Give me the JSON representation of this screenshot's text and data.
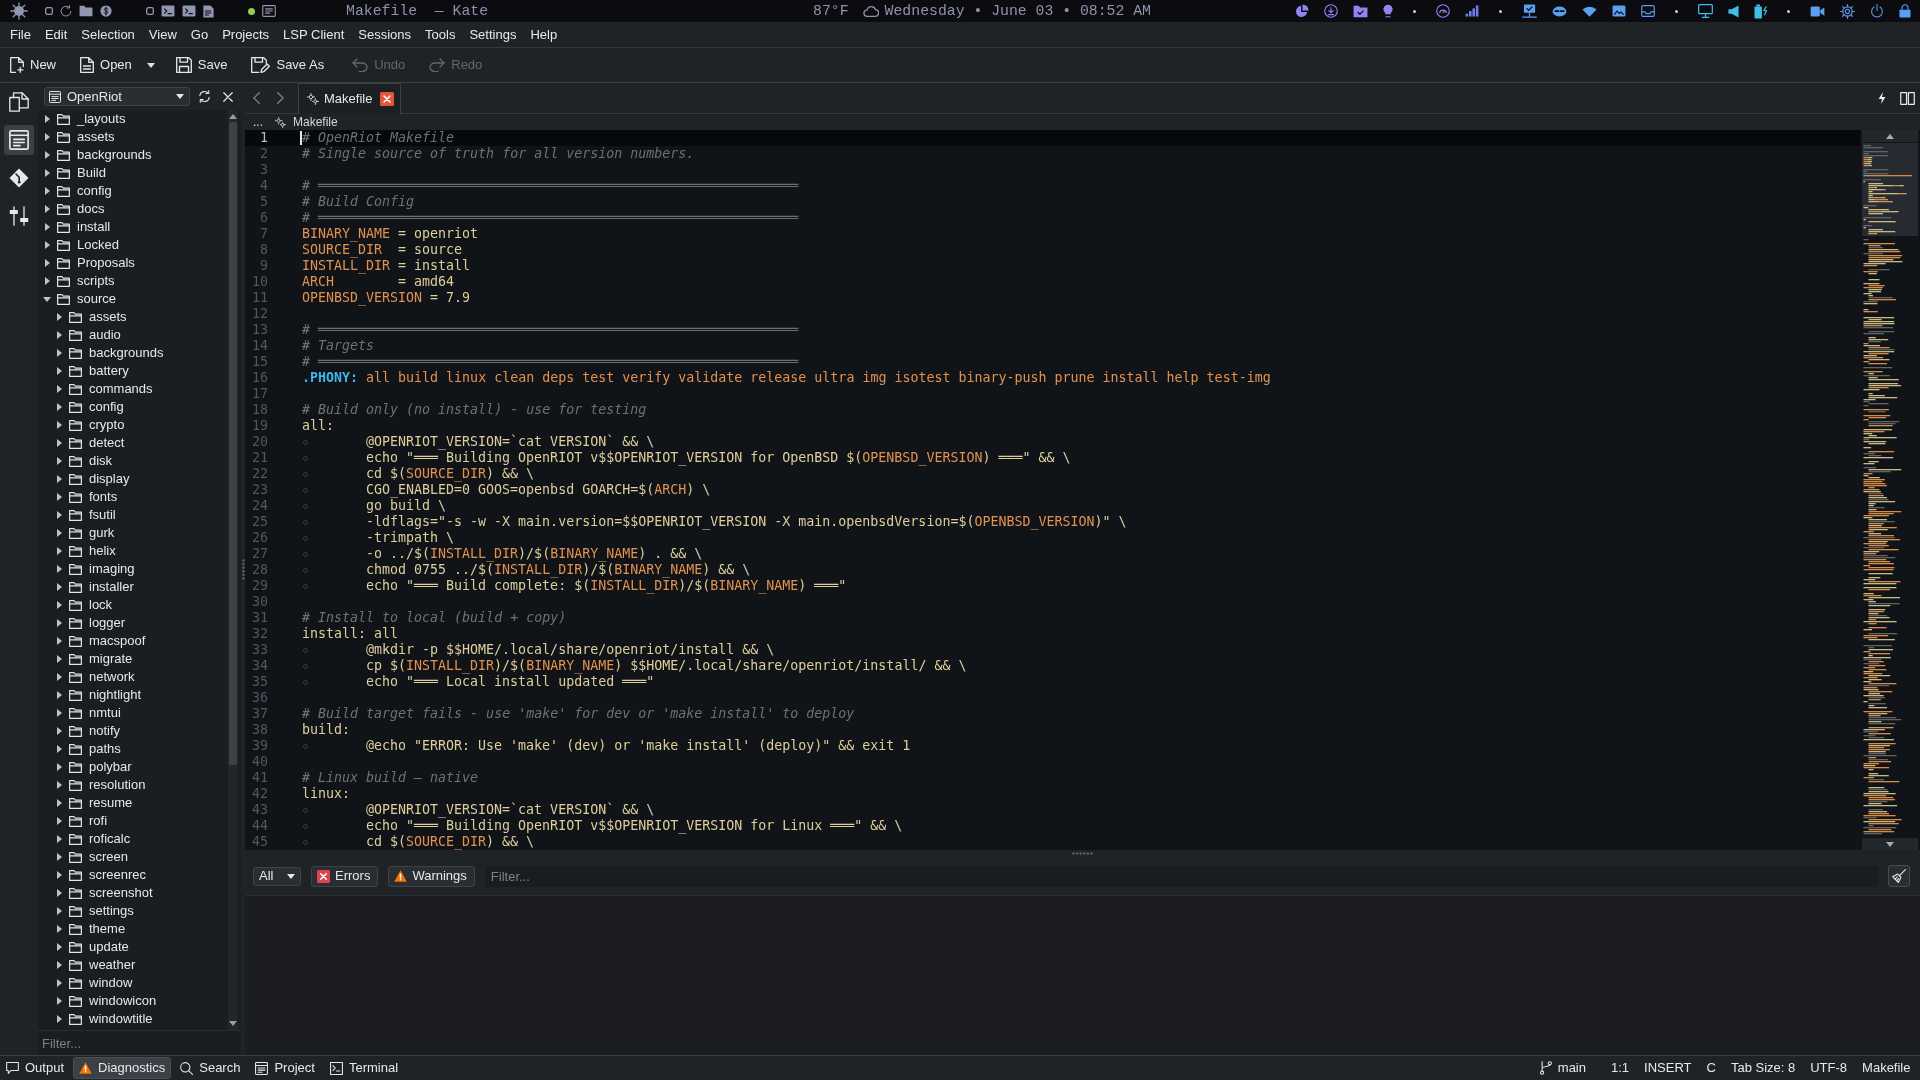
{
  "top_panel": {
    "title": "Makefile  — Kate",
    "weather": "87°F",
    "clock": "Wednesday • June 03 • 08:52 AM"
  },
  "menu_bar": [
    "File",
    "Edit",
    "Selection",
    "View",
    "Go",
    "Projects",
    "LSP Client",
    "Sessions",
    "Tools",
    "Settings",
    "Help"
  ],
  "toolbar": [
    {
      "kind": "new",
      "label": "New",
      "disabled": false,
      "dropdown": false
    },
    {
      "kind": "open",
      "label": "Open",
      "disabled": false,
      "dropdown": true
    },
    {
      "kind": "save",
      "label": "Save",
      "disabled": false,
      "dropdown": false
    },
    {
      "kind": "save_as",
      "label": "Save As",
      "disabled": false,
      "dropdown": false
    },
    {
      "kind": "undo",
      "label": "Undo",
      "disabled": true,
      "dropdown": false
    },
    {
      "kind": "redo",
      "label": "Redo",
      "disabled": true,
      "dropdown": false
    }
  ],
  "tool_views": [
    {
      "kind": "documents",
      "selected": false
    },
    {
      "kind": "projects",
      "selected": true
    },
    {
      "kind": "git",
      "selected": false
    },
    {
      "kind": "compare",
      "selected": false
    }
  ],
  "sidebar": {
    "project": "OpenRiot",
    "tree": [
      {
        "label": "_layouts",
        "expanded": false
      },
      {
        "label": "assets",
        "expanded": false
      },
      {
        "label": "backgrounds",
        "expanded": false
      },
      {
        "label": "Build",
        "expanded": false
      },
      {
        "label": "config",
        "expanded": false
      },
      {
        "label": "docs",
        "expanded": false
      },
      {
        "label": "install",
        "expanded": false
      },
      {
        "label": "Locked",
        "expanded": false
      },
      {
        "label": "Proposals",
        "expanded": false
      },
      {
        "label": "scripts",
        "expanded": false
      },
      {
        "label": "source",
        "expanded": true,
        "children": [
          {
            "label": "assets",
            "expanded": false
          },
          {
            "label": "audio",
            "expanded": false
          },
          {
            "label": "backgrounds",
            "expanded": false
          },
          {
            "label": "battery",
            "expanded": false
          },
          {
            "label": "commands",
            "expanded": false
          },
          {
            "label": "config",
            "expanded": false
          },
          {
            "label": "crypto",
            "expanded": false
          },
          {
            "label": "detect",
            "expanded": false
          },
          {
            "label": "disk",
            "expanded": false
          },
          {
            "label": "display",
            "expanded": false
          },
          {
            "label": "fonts",
            "expanded": false
          },
          {
            "label": "fsutil",
            "expanded": false
          },
          {
            "label": "gurk",
            "expanded": false
          },
          {
            "label": "helix",
            "expanded": false
          },
          {
            "label": "imaging",
            "expanded": false
          },
          {
            "label": "installer",
            "expanded": false
          },
          {
            "label": "lock",
            "expanded": false
          },
          {
            "label": "logger",
            "expanded": false
          },
          {
            "label": "macspoof",
            "expanded": false
          },
          {
            "label": "migrate",
            "expanded": false
          },
          {
            "label": "network",
            "expanded": false
          },
          {
            "label": "nightlight",
            "expanded": false
          },
          {
            "label": "nmtui",
            "expanded": false
          },
          {
            "label": "notify",
            "expanded": false
          },
          {
            "label": "paths",
            "expanded": false
          },
          {
            "label": "polybar",
            "expanded": false
          },
          {
            "label": "resolution",
            "expanded": false
          },
          {
            "label": "resume",
            "expanded": false
          },
          {
            "label": "rofi",
            "expanded": false
          },
          {
            "label": "roficalc",
            "expanded": false
          },
          {
            "label": "screen",
            "expanded": false
          },
          {
            "label": "screenrec",
            "expanded": false
          },
          {
            "label": "screenshot",
            "expanded": false
          },
          {
            "label": "settings",
            "expanded": false
          },
          {
            "label": "theme",
            "expanded": false
          },
          {
            "label": "update",
            "expanded": false
          },
          {
            "label": "weather",
            "expanded": false
          },
          {
            "label": "window",
            "expanded": false
          },
          {
            "label": "windowicon",
            "expanded": false
          },
          {
            "label": "windowtitle",
            "expanded": false
          }
        ]
      }
    ],
    "filter": {
      "placeholder": "Filter..."
    }
  },
  "editor": {
    "tabs": [
      {
        "label": "Makefile",
        "selected": true
      }
    ],
    "breadcrumb": {
      "more": "...",
      "file": "Makefile"
    },
    "lines": [
      {
        "number": "1",
        "selected": true,
        "indent": false,
        "segments": [
          {
            "kind": "comment",
            "text": "# OpenRiot Makefile"
          }
        ]
      },
      {
        "number": "2",
        "selected": false,
        "indent": false,
        "segments": [
          {
            "kind": "comment",
            "text": "# Single source of truth for all version numbers."
          }
        ]
      },
      {
        "number": "3",
        "selected": false,
        "indent": false
      },
      {
        "number": "4",
        "selected": false,
        "indent": false,
        "segments": [
          {
            "kind": "comment",
            "text": "# ════════════════════════════════════════════════════════════"
          }
        ]
      },
      {
        "number": "5",
        "selected": false,
        "indent": false,
        "segments": [
          {
            "kind": "comment",
            "text": "# Build Config"
          }
        ]
      },
      {
        "number": "6",
        "selected": false,
        "indent": false,
        "segments": [
          {
            "kind": "comment",
            "text": "# ════════════════════════════════════════════════════════════"
          }
        ]
      },
      {
        "number": "7",
        "selected": false,
        "indent": false,
        "segments": [
          {
            "kind": "var",
            "text": "BINARY_NAME"
          },
          {
            "kind": "plain",
            "text": " = openriot"
          }
        ]
      },
      {
        "number": "8",
        "selected": false,
        "indent": false,
        "segments": [
          {
            "kind": "var",
            "text": "SOURCE_DIR"
          },
          {
            "kind": "plain",
            "text": "  = source"
          }
        ]
      },
      {
        "number": "9",
        "selected": false,
        "indent": false,
        "segments": [
          {
            "kind": "var",
            "text": "INSTALL_DIR"
          },
          {
            "kind": "plain",
            "text": " = install"
          }
        ]
      },
      {
        "number": "10",
        "selected": false,
        "indent": false,
        "segments": [
          {
            "kind": "var",
            "text": "ARCH"
          },
          {
            "kind": "plain",
            "text": "        = amd64"
          }
        ]
      },
      {
        "number": "11",
        "selected": false,
        "indent": false,
        "segments": [
          {
            "kind": "var",
            "text": "OPENBSD_VERSION"
          },
          {
            "kind": "plain",
            "text": " = 7.9"
          }
        ]
      },
      {
        "number": "12",
        "selected": false,
        "indent": false
      },
      {
        "number": "13",
        "selected": false,
        "indent": false,
        "segments": [
          {
            "kind": "comment",
            "text": "# ════════════════════════════════════════════════════════════"
          }
        ]
      },
      {
        "number": "14",
        "selected": false,
        "indent": false,
        "segments": [
          {
            "kind": "comment",
            "text": "# Targets"
          }
        ]
      },
      {
        "number": "15",
        "selected": false,
        "indent": false,
        "segments": [
          {
            "kind": "comment",
            "text": "# ════════════════════════════════════════════════════════════"
          }
        ]
      },
      {
        "number": "16",
        "selected": false,
        "indent": false,
        "segments": [
          {
            "kind": "keyword",
            "text": ".PHONY:"
          },
          {
            "kind": "var",
            "text": " all build linux clean deps test verify validate release ultra img isotest binary-push prune install help test-img"
          }
        ]
      },
      {
        "number": "17",
        "selected": false,
        "indent": false
      },
      {
        "number": "18",
        "selected": false,
        "indent": false,
        "segments": [
          {
            "kind": "comment",
            "text": "# Build only (no install) - use for testing"
          }
        ]
      },
      {
        "number": "19",
        "selected": false,
        "indent": false,
        "segments": [
          {
            "kind": "plain",
            "text": "all:"
          }
        ]
      },
      {
        "number": "20",
        "selected": false,
        "indent": true,
        "segments": [
          {
            "kind": "plain",
            "text": "@OPENRIOT_VERSION=`cat VERSION` && \\"
          }
        ]
      },
      {
        "number": "21",
        "selected": false,
        "indent": true,
        "segments": [
          {
            "kind": "plain",
            "text": "echo \"═══ Building OpenRIOT v$$OPENRIOT_VERSION for OpenBSD $("
          },
          {
            "kind": "var",
            "text": "OPENBSD_VERSION"
          },
          {
            "kind": "plain",
            "text": ") ═══\" && \\"
          }
        ]
      },
      {
        "number": "22",
        "selected": false,
        "indent": true,
        "segments": [
          {
            "kind": "plain",
            "text": "cd $("
          },
          {
            "kind": "var",
            "text": "SOURCE_DIR"
          },
          {
            "kind": "plain",
            "text": ") && \\"
          }
        ]
      },
      {
        "number": "23",
        "selected": false,
        "indent": true,
        "segments": [
          {
            "kind": "plain",
            "text": "CGO_ENABLED=0 GOOS=openbsd GOARCH=$("
          },
          {
            "kind": "var",
            "text": "ARCH"
          },
          {
            "kind": "plain",
            "text": ") \\"
          }
        ]
      },
      {
        "number": "24",
        "selected": false,
        "indent": true,
        "segments": [
          {
            "kind": "plain",
            "text": "go build \\"
          }
        ]
      },
      {
        "number": "25",
        "selected": false,
        "indent": true,
        "segments": [
          {
            "kind": "plain",
            "text": "-ldflags=\"-s -w -X main.version=$$OPENRIOT_VERSION -X main.openbsdVersion=$("
          },
          {
            "kind": "var",
            "text": "OPENBSD_VERSION"
          },
          {
            "kind": "plain",
            "text": ")\" \\"
          }
        ]
      },
      {
        "number": "26",
        "selected": false,
        "indent": true,
        "segments": [
          {
            "kind": "plain",
            "text": "-trimpath \\"
          }
        ]
      },
      {
        "number": "27",
        "selected": false,
        "indent": true,
        "segments": [
          {
            "kind": "plain",
            "text": "-o ../$("
          },
          {
            "kind": "var",
            "text": "INSTALL_DIR"
          },
          {
            "kind": "plain",
            "text": ")/$("
          },
          {
            "kind": "var",
            "text": "BINARY_NAME"
          },
          {
            "kind": "plain",
            "text": ") . && \\"
          }
        ]
      },
      {
        "number": "28",
        "selected": false,
        "indent": true,
        "segments": [
          {
            "kind": "plain",
            "text": "chmod 0755 ../$("
          },
          {
            "kind": "var",
            "text": "INSTALL_DIR"
          },
          {
            "kind": "plain",
            "text": ")/$("
          },
          {
            "kind": "var",
            "text": "BINARY_NAME"
          },
          {
            "kind": "plain",
            "text": ") && \\"
          }
        ]
      },
      {
        "number": "29",
        "selected": false,
        "indent": true,
        "segments": [
          {
            "kind": "plain",
            "text": "echo \"═══ Build complete: $("
          },
          {
            "kind": "var",
            "text": "INSTALL_DIR"
          },
          {
            "kind": "plain",
            "text": ")/$("
          },
          {
            "kind": "var",
            "text": "BINARY_NAME"
          },
          {
            "kind": "plain",
            "text": ") ═══\""
          }
        ]
      },
      {
        "number": "30",
        "selected": false,
        "indent": false
      },
      {
        "number": "31",
        "selected": false,
        "indent": false,
        "segments": [
          {
            "kind": "comment",
            "text": "# Install to local (build + copy)"
          }
        ]
      },
      {
        "number": "32",
        "selected": false,
        "indent": false,
        "segments": [
          {
            "kind": "plain",
            "text": "install: all"
          }
        ]
      },
      {
        "number": "33",
        "selected": false,
        "indent": true,
        "segments": [
          {
            "kind": "plain",
            "text": "@mkdir -p $$HOME/.local/share/openriot/install && \\"
          }
        ]
      },
      {
        "number": "34",
        "selected": false,
        "indent": true,
        "segments": [
          {
            "kind": "plain",
            "text": "cp $("
          },
          {
            "kind": "var",
            "text": "INSTALL_DIR"
          },
          {
            "kind": "plain",
            "text": ")/$("
          },
          {
            "kind": "var",
            "text": "BINARY_NAME"
          },
          {
            "kind": "plain",
            "text": ") $$HOME/.local/share/openriot/install/ && \\"
          }
        ]
      },
      {
        "number": "35",
        "selected": false,
        "indent": true,
        "segments": [
          {
            "kind": "plain",
            "text": "echo \"═══ Local install updated ═══\""
          }
        ]
      },
      {
        "number": "36",
        "selected": false,
        "indent": false
      },
      {
        "number": "37",
        "selected": false,
        "indent": false,
        "segments": [
          {
            "kind": "comment",
            "text": "# Build target fails - use 'make' for dev or 'make install' to deploy"
          }
        ]
      },
      {
        "number": "38",
        "selected": false,
        "indent": false,
        "segments": [
          {
            "kind": "plain",
            "text": "build:"
          }
        ]
      },
      {
        "number": "39",
        "selected": false,
        "indent": true,
        "segments": [
          {
            "kind": "plain",
            "text": "@echo \"ERROR: Use 'make' (dev) or 'make install' (deploy)\" && exit 1"
          }
        ]
      },
      {
        "number": "40",
        "selected": false,
        "indent": false
      },
      {
        "number": "41",
        "selected": false,
        "indent": false,
        "segments": [
          {
            "kind": "comment",
            "text": "# Linux build — native"
          }
        ]
      },
      {
        "number": "42",
        "selected": false,
        "indent": false,
        "segments": [
          {
            "kind": "plain",
            "text": "linux:"
          }
        ]
      },
      {
        "number": "43",
        "selected": false,
        "indent": true,
        "segments": [
          {
            "kind": "plain",
            "text": "@OPENRIOT_VERSION=`cat VERSION` && \\"
          }
        ]
      },
      {
        "number": "44",
        "selected": false,
        "indent": true,
        "segments": [
          {
            "kind": "plain",
            "text": "echo \"═══ Building OpenRIOT v$$OPENRIOT_VERSION for Linux ═══\" && \\"
          }
        ]
      },
      {
        "number": "45",
        "selected": false,
        "indent": true,
        "segments": [
          {
            "kind": "plain",
            "text": "cd $("
          },
          {
            "kind": "var",
            "text": "SOURCE_DIR"
          },
          {
            "kind": "plain",
            "text": ") && \\"
          }
        ]
      }
    ]
  },
  "diagnostics": {
    "scope": "All",
    "filters": [
      {
        "kind": "errors",
        "label": "Errors"
      },
      {
        "kind": "warnings",
        "label": "Warnings"
      }
    ],
    "search": {
      "placeholder": "Filter..."
    }
  },
  "status_bar": {
    "panels": [
      {
        "kind": "output",
        "label": "Output",
        "selected": false
      },
      {
        "kind": "diagnostics",
        "label": "Diagnostics",
        "selected": true
      },
      {
        "kind": "search",
        "label": "Search",
        "selected": false
      },
      {
        "kind": "project",
        "label": "Project",
        "selected": false
      },
      {
        "kind": "terminal",
        "label": "Terminal",
        "selected": false
      }
    ],
    "branch": "main",
    "cursor": "1:1",
    "input_mode": "INSERT",
    "dictionary": "C",
    "tab_size": "Tab Size: 8",
    "encoding": "UTF-8",
    "mode": "Makefile"
  }
}
